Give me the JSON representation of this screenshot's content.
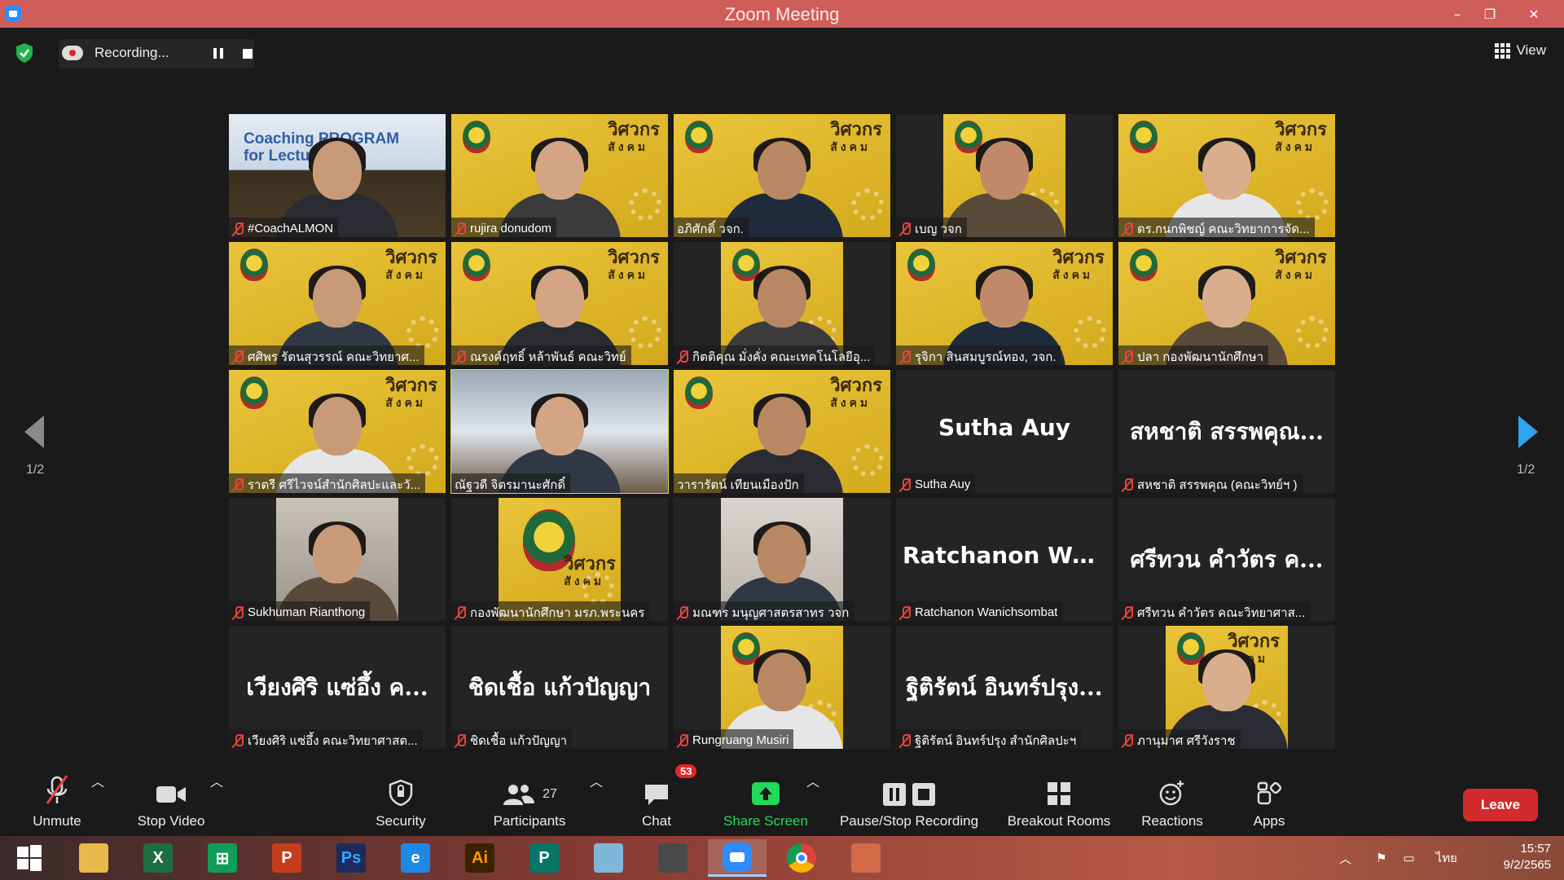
{
  "window": {
    "title": "Zoom Meeting",
    "minimize": "–",
    "restore": "❐",
    "close": "✕"
  },
  "topbar": {
    "recording_label": "Recording...",
    "view_label": "View"
  },
  "pagination": {
    "left": "1/2",
    "right": "1/2"
  },
  "tiles": [
    {
      "name": "#CoachALMON",
      "kind": "video",
      "video_title": "Coaching PROGRAM\nfor Lecturer"
    },
    {
      "name": "rujira donudom",
      "kind": "video"
    },
    {
      "name": "อภิศักดิ์ วจก.",
      "kind": "video"
    },
    {
      "name": "เบญ วจก",
      "kind": "video"
    },
    {
      "name": "ดร.กนกพิชญ์ คณะวิทยาการจัด...",
      "kind": "video"
    },
    {
      "name": "ศศิพร รัตนสุวรรณ์ คณะวิทยาศ...",
      "kind": "video"
    },
    {
      "name": "ณรงค์ฤทธิ์ หล้าพันธ์ คณะวิทย์",
      "kind": "video"
    },
    {
      "name": "กิตติคุณ มั่งคั่ง คณะเทคโนโลยีอุ...",
      "kind": "video"
    },
    {
      "name": "รุจิกา สินสมบูรณ์ทอง, วจก.",
      "kind": "video"
    },
    {
      "name": "ปลา กองพัฒนานักศึกษา",
      "kind": "video"
    },
    {
      "name": "ราตรี ศรีไวจน์สำนักศิลปะและวั...",
      "kind": "video"
    },
    {
      "name": "ณัฐวดี จิตรมานะศักดิ์",
      "kind": "video",
      "speaking": true
    },
    {
      "name": "วารารัตน์ เทียนเมืองปัก",
      "kind": "video"
    },
    {
      "name": "Sutha Auy",
      "kind": "name",
      "display_name": "Sutha Auy"
    },
    {
      "name": "สหชาติ สรรพคุณ (คณะวิทย์ฯ )",
      "kind": "name",
      "display_name": "สหชาติ สรรพคุณ..."
    },
    {
      "name": "Sukhuman Rianthong",
      "kind": "video"
    },
    {
      "name": "กองพัฒนานักศึกษา มรภ.พระนคร",
      "kind": "video"
    },
    {
      "name": "มณฑร มนุญศาสตรสาทร วจก",
      "kind": "video"
    },
    {
      "name": "Ratchanon Wanichsombat",
      "kind": "name",
      "display_name": "Ratchanon  Wan..."
    },
    {
      "name": "ศรีทวน คำวัตร คณะวิทยาศาส...",
      "kind": "name",
      "display_name": "ศรีทวน  คำวัตร ค..."
    },
    {
      "name": "เวียงศิริ แซ่อึ้ง คณะวิทยาศาสต...",
      "kind": "name",
      "display_name": "เวียงศิริ  แซ่อึ้ง  ค..."
    },
    {
      "name": "ชิดเชื้อ แก้วปัญญา",
      "kind": "name",
      "display_name": "ชิดเชื้อ แก้วปัญญา"
    },
    {
      "name": "Rungruang Musiri",
      "kind": "video"
    },
    {
      "name": "ฐิติรัตน์ อินทร์ปรุง สำนักศิลปะฯ",
      "kind": "name",
      "display_name": "ฐิติรัตน์ อินทร์ปรุง..."
    },
    {
      "name": "ภานุมาศ ศรีวังราช",
      "kind": "video"
    }
  ],
  "brand_text": {
    "big": "วิศวกร",
    "small": "สังคม"
  },
  "toolbar": {
    "unmute": "Unmute",
    "stop_video": "Stop Video",
    "security": "Security",
    "participants": "Participants",
    "participants_count": "27",
    "chat": "Chat",
    "chat_badge": "53",
    "share_screen": "Share Screen",
    "pause_stop_recording": "Pause/Stop Recording",
    "breakout_rooms": "Breakout Rooms",
    "reactions": "Reactions",
    "apps": "Apps",
    "leave": "Leave"
  },
  "taskbar": {
    "apps": [
      {
        "id": "start",
        "glyph": ""
      },
      {
        "id": "file-explorer",
        "glyph": ""
      },
      {
        "id": "excel",
        "glyph": "X"
      },
      {
        "id": "sheets",
        "glyph": "⊞"
      },
      {
        "id": "powerpoint",
        "glyph": "P"
      },
      {
        "id": "photoshop",
        "glyph": "Ps"
      },
      {
        "id": "edge",
        "glyph": "e"
      },
      {
        "id": "illustrator",
        "glyph": "Ai"
      },
      {
        "id": "publisher",
        "glyph": "P"
      },
      {
        "id": "notepad",
        "glyph": ""
      },
      {
        "id": "photoscape",
        "glyph": ""
      },
      {
        "id": "zoom",
        "glyph": ""
      },
      {
        "id": "chrome",
        "glyph": ""
      },
      {
        "id": "photos",
        "glyph": ""
      }
    ],
    "language": "ไทย",
    "time": "15:57",
    "date": "9/2/2565"
  },
  "colors": {
    "accent_red": "#cf5d5a",
    "speaking_outline": "#d6df37",
    "share_green": "#23d959",
    "leave_red": "#d22b2b"
  }
}
